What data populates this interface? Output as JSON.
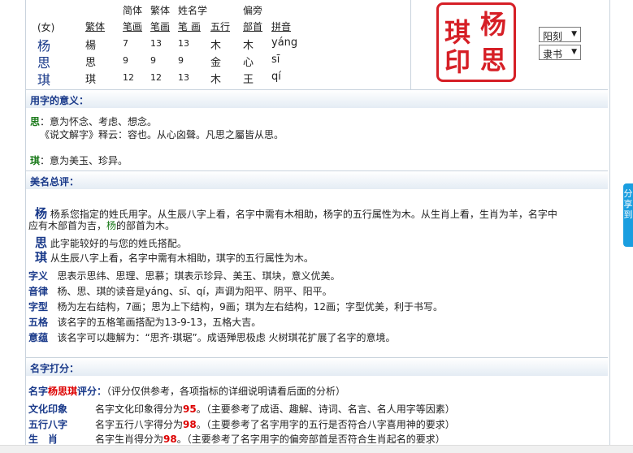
{
  "header_table": {
    "gender": "(女)",
    "col_top": [
      "简体",
      "繁体",
      "姓名学",
      "偏旁"
    ],
    "col_headers": [
      "繁体",
      "笔画",
      "笔画",
      "笔 画",
      "五行",
      "部首",
      "拼音"
    ],
    "rows": [
      {
        "name": "杨",
        "trad": "楊",
        "jian": "7",
        "fan": "13",
        "xm": "13",
        "wx": "木",
        "bs": "木",
        "py": "yáng"
      },
      {
        "name": "思",
        "trad": "思",
        "jian": "9",
        "fan": "9",
        "xm": "9",
        "wx": "金",
        "bs": "心",
        "py": "sī"
      },
      {
        "name": "琪",
        "trad": "琪",
        "jian": "12",
        "fan": "12",
        "xm": "13",
        "wx": "木",
        "bs": "王",
        "py": "qí"
      }
    ]
  },
  "seal": {
    "chars": [
      "杨",
      "琪",
      "思",
      "印"
    ]
  },
  "selects": {
    "style1": "阳刻",
    "style2": "隶书"
  },
  "section1": {
    "title": "用字的意义：",
    "si_char": "思",
    "si_text": "：意为怀念、考虑、想念。",
    "si_quote": "《说文解字》释云：容也。从心囟聲。凡思之屬皆从思。",
    "qi_char": "琪",
    "qi_text": "：意为美玉、珍异。"
  },
  "section2": {
    "title": "美名总评：",
    "yang_char": "杨",
    "yang_text1": "杨系您指定的姓氏用字。从生辰八字上看，名字中需有木相助，杨字的五行属性为木。从生肖上看，生肖为羊，名字中",
    "yang_text2a": "应有木部首为吉，",
    "yang_text2b": "杨",
    "yang_text2c": "的部首为木。",
    "si_char": "思",
    "si_text": "此字能较好的与您的姓氏搭配。",
    "qi_char": "琪",
    "qi_text": "从生辰八字上看，名字中需有木相助，琪字的五行属性为木。",
    "rows": [
      {
        "label": "字义",
        "text": "思表示思纬、思理、思慕；琪表示珍异、美玉、琪块，意义优美。"
      },
      {
        "label": "音律",
        "text": "杨、思、琪的读音是yáng、sī、qí，声调为阳平、阴平、阳平。"
      },
      {
        "label": "字型",
        "text": "杨为左右结构，7画；思为上下结构，9画；琪为左右结构，12画；字型优美，利于书写。"
      },
      {
        "label": "五格",
        "text": "该名字的五格笔画搭配为13-9-13，五格大吉。"
      },
      {
        "label": "意蕴",
        "text": "该名字可以趣解为：“思齐·琪琚”。成语殚思极虑 火树琪花扩展了名字的意境。"
      }
    ]
  },
  "section3": {
    "title": "名字打分：",
    "intro_pre": "名字",
    "intro_name": "杨思琪",
    "intro_post": "评分：",
    "intro_note": "（评分仅供参考，各项指标的详细说明请看后面的分析）",
    "rows": [
      {
        "label": "文化印象",
        "pre": "名字文化印象得分为",
        "score": "95",
        "post": "。（主要参考了成语、趣解、诗词、名言、名人用字等因素）"
      },
      {
        "label": "五行八字",
        "pre": "名字五行八字得分为",
        "score": "98",
        "post": "。（主要参考了名字用字的五行是否符合八字喜用神的要求）"
      },
      {
        "label": "生　肖",
        "pre": "名字生肖得分为",
        "score": "98",
        "post": "。（主要参考了名字用字的偏旁部首是否符合生肖起名的要求）"
      }
    ]
  },
  "side_tab": "分享到"
}
